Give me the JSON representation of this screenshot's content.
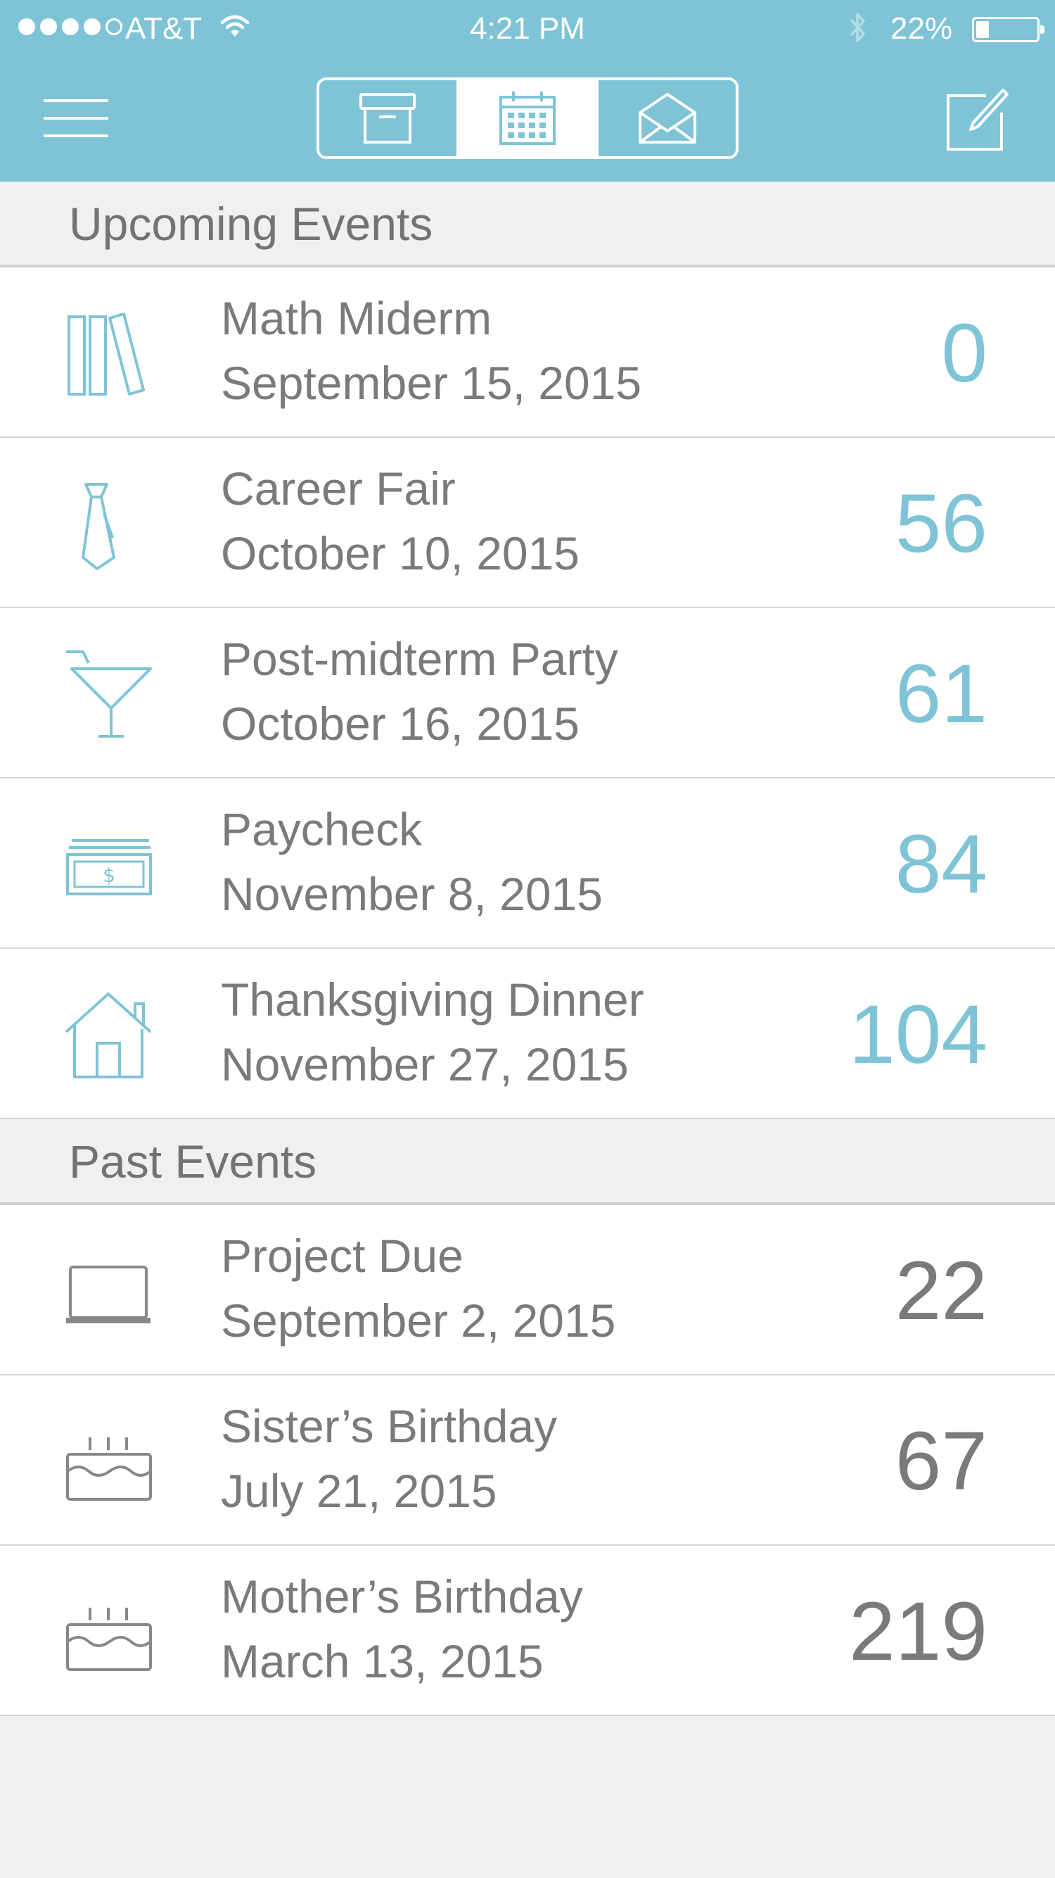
{
  "status_bar": {
    "carrier": "AT&T",
    "time": "4:21 PM",
    "battery": "22%",
    "battery_level": 0.22
  },
  "nav": {
    "tabs": [
      {
        "icon": "archive-box-icon",
        "active": false
      },
      {
        "icon": "calendar-icon",
        "active": true
      },
      {
        "icon": "envelope-icon",
        "active": false
      }
    ]
  },
  "colors": {
    "accent": "#7fc4d6",
    "past_text": "#7a7a7a",
    "background": "#f0f0f0"
  },
  "upcoming": {
    "header": "Upcoming Events",
    "events": [
      {
        "title": "Math Miderm",
        "date": "September 15, 2015",
        "count": "0",
        "icon": "books-icon"
      },
      {
        "title": "Career Fair",
        "date": "October 10, 2015",
        "count": "56",
        "icon": "necktie-icon"
      },
      {
        "title": "Post-midterm Party",
        "date": "October 16, 2015",
        "count": "61",
        "icon": "cocktail-icon"
      },
      {
        "title": "Paycheck",
        "date": "November 8, 2015",
        "count": "84",
        "icon": "cash-icon"
      },
      {
        "title": "Thanksgiving Dinner",
        "date": "November 27, 2015",
        "count": "104",
        "icon": "house-icon"
      }
    ]
  },
  "past": {
    "header": "Past Events",
    "events": [
      {
        "title": "Project Due",
        "date": "September 2, 2015",
        "count": "22",
        "icon": "laptop-icon"
      },
      {
        "title": "Sister’s Birthday",
        "date": "July 21, 2015",
        "count": "67",
        "icon": "birthday-cake-icon"
      },
      {
        "title": "Mother’s Birthday",
        "date": "March 13, 2015",
        "count": "219",
        "icon": "birthday-cake-icon"
      }
    ]
  }
}
